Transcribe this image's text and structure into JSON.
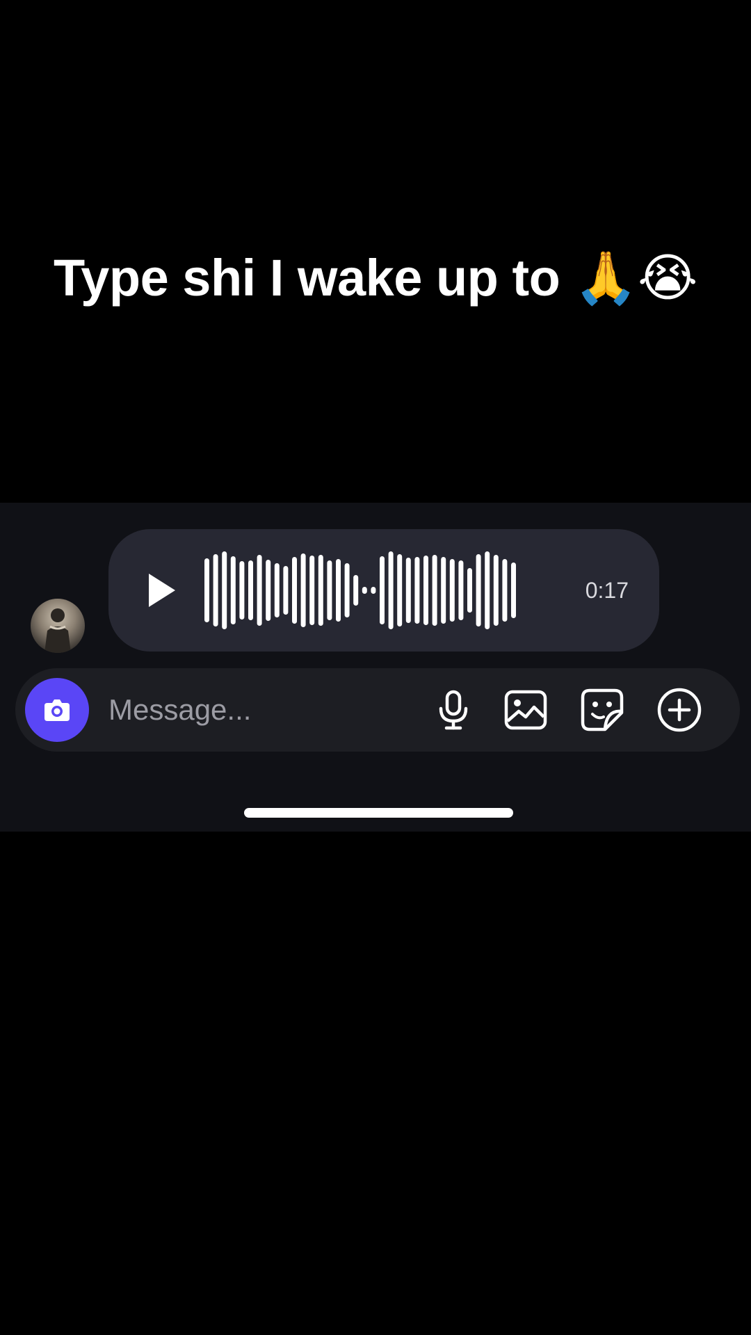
{
  "caption": {
    "text": "Type shi I wake up to",
    "emojis": "🙏😭"
  },
  "voice_message": {
    "duration": "0:17",
    "play_icon": "play-icon",
    "waveform_icon": "audio-waveform"
  },
  "sender": {
    "avatar_icon": "user-avatar"
  },
  "composer": {
    "placeholder": "Message...",
    "value": "",
    "camera_icon": "camera-icon",
    "tools": [
      "microphone-icon",
      "image-icon",
      "sticker-icon",
      "plus-circle-icon"
    ]
  },
  "colors": {
    "background": "#000000",
    "panel": "#101116",
    "bubble": "#272833",
    "composer": "#1d1e23",
    "accent": "#5a46f6",
    "text": "#ffffff",
    "placeholder": "#9c9ca4"
  }
}
